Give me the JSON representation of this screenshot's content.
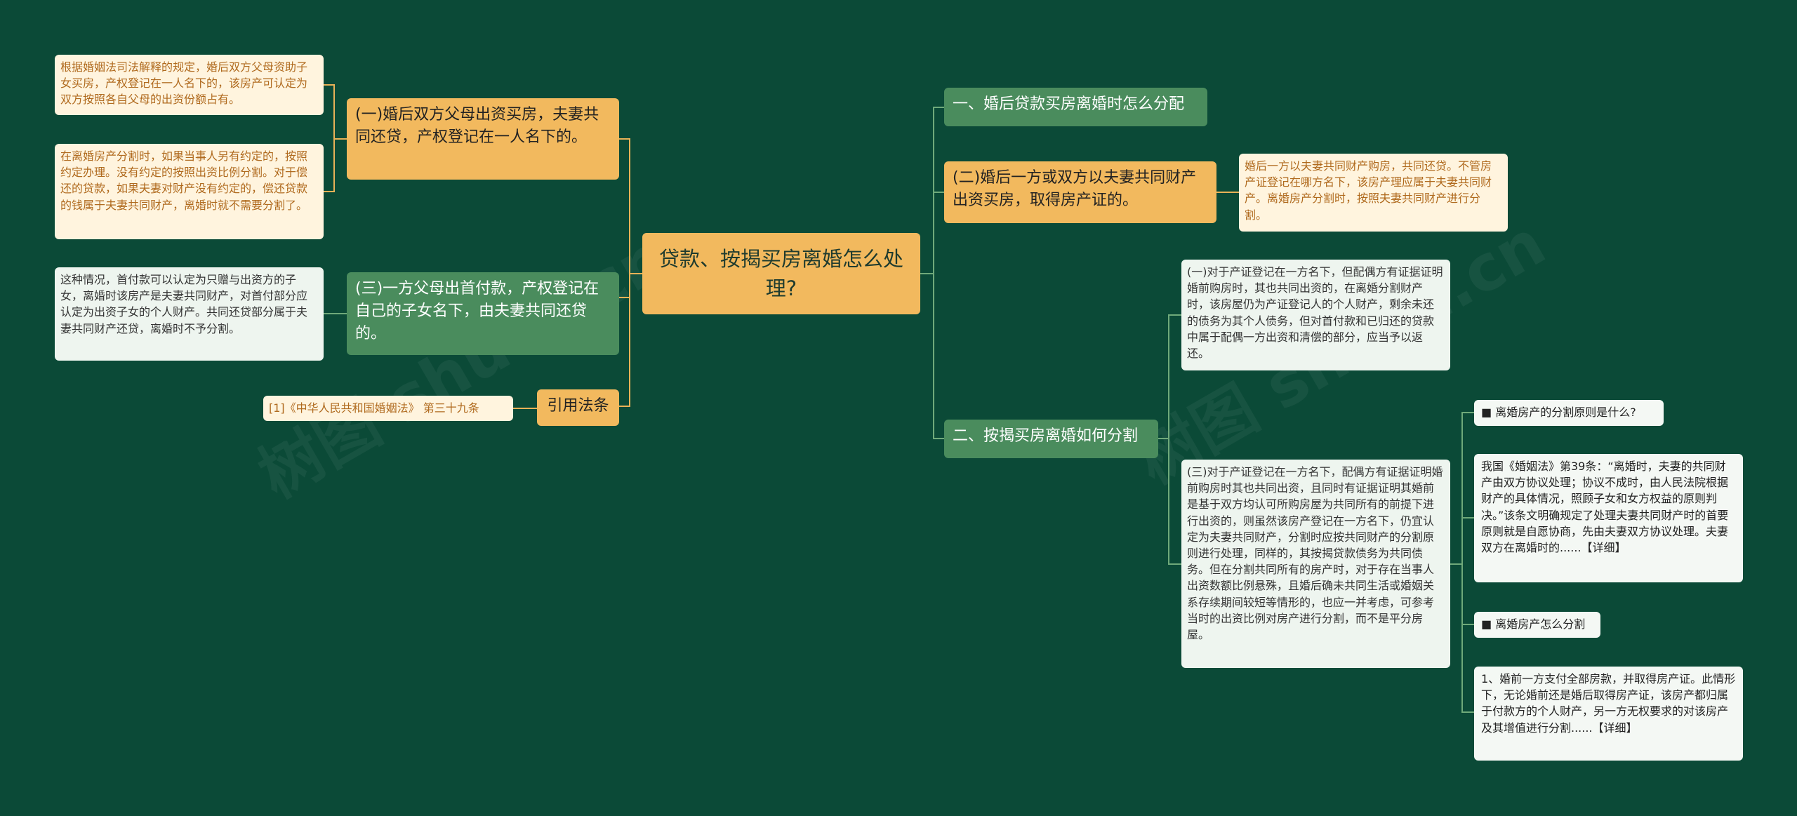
{
  "root": {
    "title": "贷款、按揭买房离婚怎么处理?"
  },
  "left": {
    "n1": {
      "label": "(一)婚后双方父母出资买房，夫妻共同还贷，产权登记在一人名下的。",
      "leaves": [
        "根据婚姻法司法解释的规定，婚后双方父母资助子女买房，产权登记在一人名下的，该房产可认定为双方按照各自父母的出资份额占有。",
        "在离婚房产分割时，如果当事人另有约定的，按照约定办理。没有约定的按照出资比例分割。对于偿还的贷款，如果夫妻对财产没有约定的，偿还贷款的钱属于夫妻共同财产，离婚时就不需要分割了。"
      ]
    },
    "n2": {
      "label": "(三)一方父母出首付款，产权登记在自己的子女名下，由夫妻共同还贷的。",
      "leaf": "这种情况，首付款可以认定为只赠与出资方的子女，离婚时该房产是夫妻共同财产，对首付部分应认定为出资子女的个人财产。共同还贷部分属于夫妻共同财产还贷，离婚时不予分割。"
    },
    "n3": {
      "label": "引用法条",
      "leaf": "[1]《中华人民共和国婚姻法》 第三十九条"
    }
  },
  "right": {
    "r1": {
      "label": "一、婚后贷款买房离婚时怎么分配"
    },
    "r2": {
      "label": "(二)婚后一方或双方以夫妻共同财产出资买房，取得房产证的。",
      "leaf": "婚后一方以夫妻共同财产购房，共同还贷。不管房产证登记在哪方名下，该房产理应属于夫妻共同财产。离婚房产分割时，按照夫妻共同财产进行分割。"
    },
    "r3": {
      "label": "二、按揭买房离婚如何分割",
      "sub1": "(一)对于产证登记在一方名下，但配偶方有证据证明婚前购房时，其也共同出资的，在离婚分割财产时，该房屋仍为产证登记人的个人财产，剩余未还的债务为其个人债务，但对首付款和已归还的贷款中属于配偶一方出资和清偿的部分，应当予以返还。",
      "sub2": "(三)对于产证登记在一方名下，配偶方有证据证明婚前购房时其也共同出资，且同时有证据证明其婚前是基于双方均认可所购房屋为共同所有的前提下进行出资的，则虽然该房产登记在一方名下，仍宜认定为夫妻共同财产，分割时应按共同财产的分割原则进行处理，同样的，其按揭贷款债务为共同债务。但在分割共同所有的房产时，对于存在当事人出资数额比例悬殊，且婚后确未共同生活或婚姻关系存续期间较短等情形的，也应一并考虑，可参考当时的出资比例对房产进行分割，而不是平分房屋。",
      "q1": "■ 离婚房产的分割原则是什么?",
      "a1": "我国《婚姻法》第39条：“离婚时，夫妻的共同财产由双方协议处理；协议不成时，由人民法院根据财产的具体情况，照顾子女和女方权益的原则判决。”该条文明确规定了处理夫妻共同财产时的首要原则就是自愿协商，先由夫妻双方协议处理。夫妻双方在离婚时的......【详细】",
      "q2": "■ 离婚房产怎么分割",
      "a2": "1、婚前一方支付全部房款，并取得房产证。此情形下，无论婚前还是婚后取得房产证，该房产都归属于付款方的个人财产，另一方无权要求的对该房产及其增值进行分割......【详细】"
    }
  },
  "colors": {
    "background": "#0b4a37",
    "orange": "#f2b95e",
    "green": "#4a8c5d",
    "line_orange": "#e9b257",
    "line_green": "#6fa97a"
  }
}
